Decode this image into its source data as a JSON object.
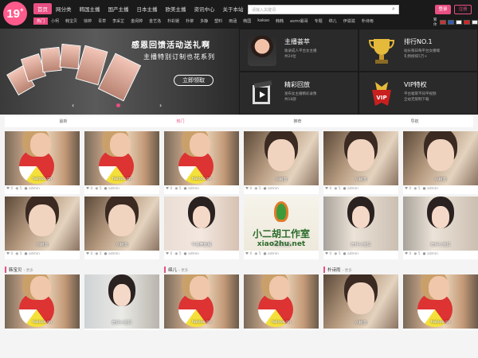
{
  "header": {
    "logo": "19",
    "logo_plus": "+",
    "nav": [
      {
        "label": "首页",
        "active": true
      },
      {
        "label": "网分类"
      },
      {
        "label": "韩国主播"
      },
      {
        "label": "国产主播"
      },
      {
        "label": "日本主播"
      },
      {
        "label": "欧美主播"
      },
      {
        "label": "资讯中心"
      },
      {
        "label": "关于本站"
      }
    ],
    "search_placeholder": "请输入关键词",
    "login": "登录",
    "register": "注册",
    "subnav": [
      {
        "label": "热门",
        "active": true
      },
      {
        "label": "小柯"
      },
      {
        "label": "韩宝贝"
      },
      {
        "label": "徐婷"
      },
      {
        "label": "青草"
      },
      {
        "label": "李采芷"
      },
      {
        "label": "金闵婷"
      },
      {
        "label": "金艺洛"
      },
      {
        "label": "朴彩媛"
      },
      {
        "label": "朴柳"
      },
      {
        "label": "多静"
      },
      {
        "label": "塑料"
      },
      {
        "label": "雨涵"
      },
      {
        "label": "韩国"
      },
      {
        "label": "kakao"
      },
      {
        "label": "韩韩"
      },
      {
        "label": "asmr最哥"
      },
      {
        "label": "专题"
      },
      {
        "label": "绵儿"
      },
      {
        "label": "伊滋滋"
      },
      {
        "label": "朴诗雨"
      }
    ],
    "lang_label": "繁体",
    "flag_colors": [
      "#c33",
      "#2d5fb3",
      "#fff",
      "#d22",
      "#eee",
      "#c22"
    ]
  },
  "banner": {
    "title": "感恩回馈活动送礼啊",
    "subtitle": "主播特别订制也花系列",
    "cta": "立即领取",
    "prev": "‹",
    "next": "›"
  },
  "features": [
    {
      "title": "主播荟萃",
      "desc": "收录成人平台女主播\n共24位",
      "icon": "host-avatar-icon"
    },
    {
      "title": "排行NO.1",
      "desc": "站长每日每平台女播端\n礼物榜排5万+",
      "icon": "trophy-icon"
    },
    {
      "title": "精彩回放",
      "desc": "发布女主播精彩录像\n共18部",
      "icon": "film-icon"
    },
    {
      "title": "VIP特权",
      "desc": "平台嘘耳不同平视频\n全站无限制下载",
      "icon": "vip-badge-icon"
    }
  ],
  "tabs": [
    {
      "label": "最新"
    },
    {
      "label": "热门",
      "active": true
    },
    {
      "label": "推荐"
    },
    {
      "label": "导航"
    }
  ],
  "sections": [
    {
      "title": "韩宝贝",
      "more": "› 更多"
    },
    {
      "title": "绵儿",
      "more": "› 更多"
    },
    {
      "title": "朴诗雨",
      "more": "› 更多"
    }
  ],
  "cards_row1": [
    {
      "cap": "haiooo.cn",
      "views": "0",
      "likes": "5",
      "author": "admin",
      "style": "ball"
    },
    {
      "cap": "haiooo.cn",
      "views": "0",
      "likes": "5",
      "author": "admin",
      "style": "ball"
    },
    {
      "cap": "haiooo.cn",
      "views": "0",
      "likes": "5",
      "author": "admin",
      "style": "ball"
    },
    {
      "cap": "小树向",
      "views": "0",
      "likes": "5",
      "author": "admin",
      "style": "boy"
    },
    {
      "cap": "小树向",
      "views": "0",
      "likes": "5",
      "author": "admin",
      "style": "boy"
    },
    {
      "cap": "小树向",
      "views": "0",
      "likes": "5",
      "author": "admin",
      "style": "boy"
    }
  ],
  "cards_row2": [
    {
      "cap": "小树向",
      "views": "0",
      "likes": "5",
      "author": "admin",
      "style": "boy"
    },
    {
      "cap": "小树向",
      "views": "0",
      "likes": "5",
      "author": "admin",
      "style": "boy"
    },
    {
      "cap": "牛逼壳肚般",
      "views": "0",
      "likes": "5",
      "author": "admin",
      "style": "girl"
    },
    {
      "cap": "千逼壳肚般",
      "views": "0",
      "likes": "5",
      "author": "admin",
      "style": "watermark"
    },
    {
      "cap": "旺仔小宝贝",
      "views": "0",
      "likes": "5",
      "author": "admin",
      "style": "girl2"
    },
    {
      "cap": "旺仔小宝贝",
      "views": "0",
      "likes": "5",
      "author": "admin",
      "style": "girl2"
    }
  ],
  "cards_row3": [
    {
      "cap": "haiooo.cn",
      "style": "ball"
    },
    {
      "cap": "旺仔小宝贝",
      "style": "girl3"
    },
    {
      "cap": "haiooo.cn",
      "style": "ball"
    },
    {
      "cap": "haiooo.cn",
      "style": "ball"
    },
    {
      "cap": "小树向",
      "style": "boy"
    },
    {
      "cap": "haiooo.cn",
      "style": "ball"
    }
  ],
  "watermark": {
    "line1": "小二胡工作室",
    "line2": "xiao2hu.net"
  },
  "colors": {
    "accent": "#e94f82",
    "dark": "#1a1a1a"
  }
}
